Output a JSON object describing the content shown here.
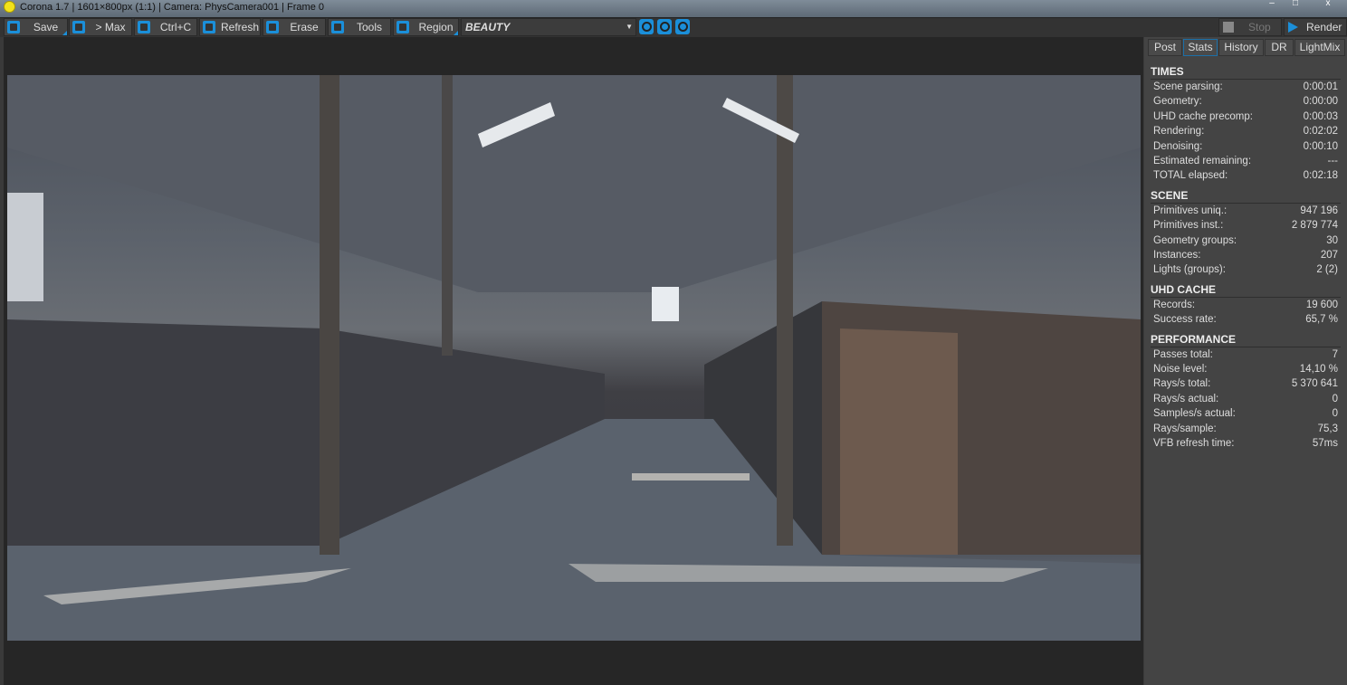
{
  "title": "Corona 1.7 | 1601×800px (1:1) | Camera: PhysCamera001 | Frame 0",
  "toolbar": {
    "save": "Save",
    "max": "> Max",
    "copy": "Ctrl+C",
    "refresh": "Refresh",
    "erase": "Erase",
    "tools": "Tools",
    "region": "Region",
    "channel": "BEAUTY",
    "stop": "Stop",
    "render": "Render"
  },
  "tabs": [
    "Post",
    "Stats",
    "History",
    "DR",
    "LightMix"
  ],
  "active_tab": "Stats",
  "stats": [
    {
      "title": "TIMES",
      "rows": [
        [
          "Scene parsing:",
          "0:00:01"
        ],
        [
          "Geometry:",
          "0:00:00"
        ],
        [
          "UHD cache precomp:",
          "0:00:03"
        ],
        [
          "Rendering:",
          "0:02:02"
        ],
        [
          "Denoising:",
          "0:00:10"
        ],
        [
          "Estimated remaining:",
          "---"
        ],
        [
          "TOTAL elapsed:",
          "0:02:18"
        ]
      ]
    },
    {
      "title": "SCENE",
      "rows": [
        [
          "Primitives uniq.:",
          "947 196"
        ],
        [
          "Primitives inst.:",
          "2 879 774"
        ],
        [
          "Geometry groups:",
          "30"
        ],
        [
          "Instances:",
          "207"
        ],
        [
          "Lights (groups):",
          "2 (2)"
        ]
      ]
    },
    {
      "title": "UHD CACHE",
      "rows": [
        [
          "Records:",
          "19 600"
        ],
        [
          "Success rate:",
          "65,7 %"
        ]
      ]
    },
    {
      "title": "PERFORMANCE",
      "rows": [
        [
          "Passes total:",
          "7"
        ],
        [
          "Noise level:",
          "14,10 %"
        ],
        [
          "Rays/s total:",
          "5 370 641"
        ],
        [
          "Rays/s actual:",
          "0"
        ],
        [
          "Samples/s actual:",
          "0"
        ],
        [
          "Rays/sample:",
          "75,3"
        ],
        [
          "VFB refresh time:",
          "57ms"
        ]
      ]
    }
  ]
}
